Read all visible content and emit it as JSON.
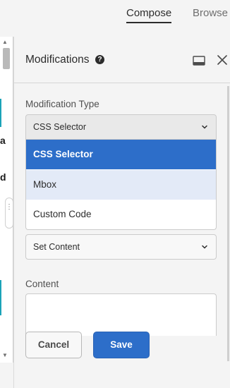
{
  "nav": {
    "tabs": [
      {
        "label": "Compose",
        "active": true
      },
      {
        "label": "Browse",
        "active": false
      }
    ]
  },
  "panel": {
    "title": "Modifications",
    "help_icon": "question-circle-icon",
    "dock_icon": "dock-panel-icon",
    "close_icon": "close-icon",
    "modification_type": {
      "label": "Modification Type",
      "value": "CSS Selector",
      "options": [
        "CSS Selector",
        "Mbox",
        "Custom Code"
      ],
      "selected_option": "CSS Selector",
      "hovered_option": "Mbox"
    },
    "action": {
      "value": "Set Content"
    },
    "content": {
      "label": "Content",
      "value": ""
    },
    "buttons": {
      "cancel": "Cancel",
      "save": "Save"
    }
  },
  "colors": {
    "accent": "#2d6ec9",
    "option_hover": "#e3eaf7",
    "background": "#f4f4f4"
  }
}
